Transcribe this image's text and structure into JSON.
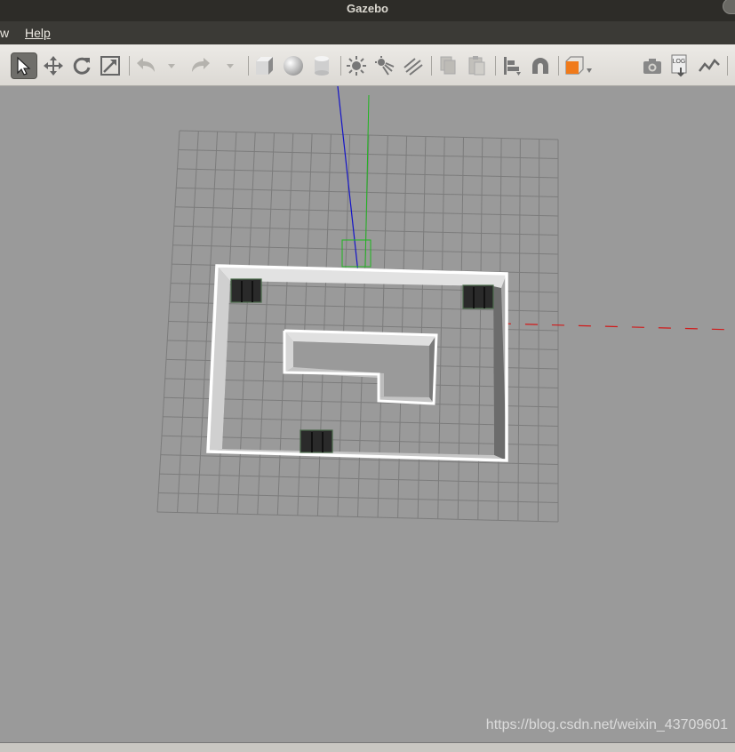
{
  "window": {
    "title": "Gazebo"
  },
  "menu": {
    "view_label": "w",
    "help_label": "Help"
  },
  "toolbar": {
    "tools": [
      "select-mode-icon",
      "translate-mode-icon",
      "rotate-mode-icon",
      "scale-mode-icon",
      "undo-icon",
      "undo-history-icon",
      "redo-icon",
      "redo-history-icon",
      "box-shape-icon",
      "sphere-shape-icon",
      "cylinder-shape-icon",
      "point-light-icon",
      "spot-light-icon",
      "directional-light-icon",
      "copy-icon",
      "paste-icon",
      "align-icon",
      "snap-icon",
      "change-view-icon",
      "screenshot-icon",
      "log-icon",
      "plot-icon"
    ],
    "log_badge": "LOG"
  },
  "viewport": {
    "watermark": "https://blog.csdn.net/weixin_43709601"
  },
  "colors": {
    "accent": "#f07a1a",
    "axis_x": "#d11a1a",
    "axis_y": "#1fb51f",
    "axis_z": "#1414c8"
  }
}
